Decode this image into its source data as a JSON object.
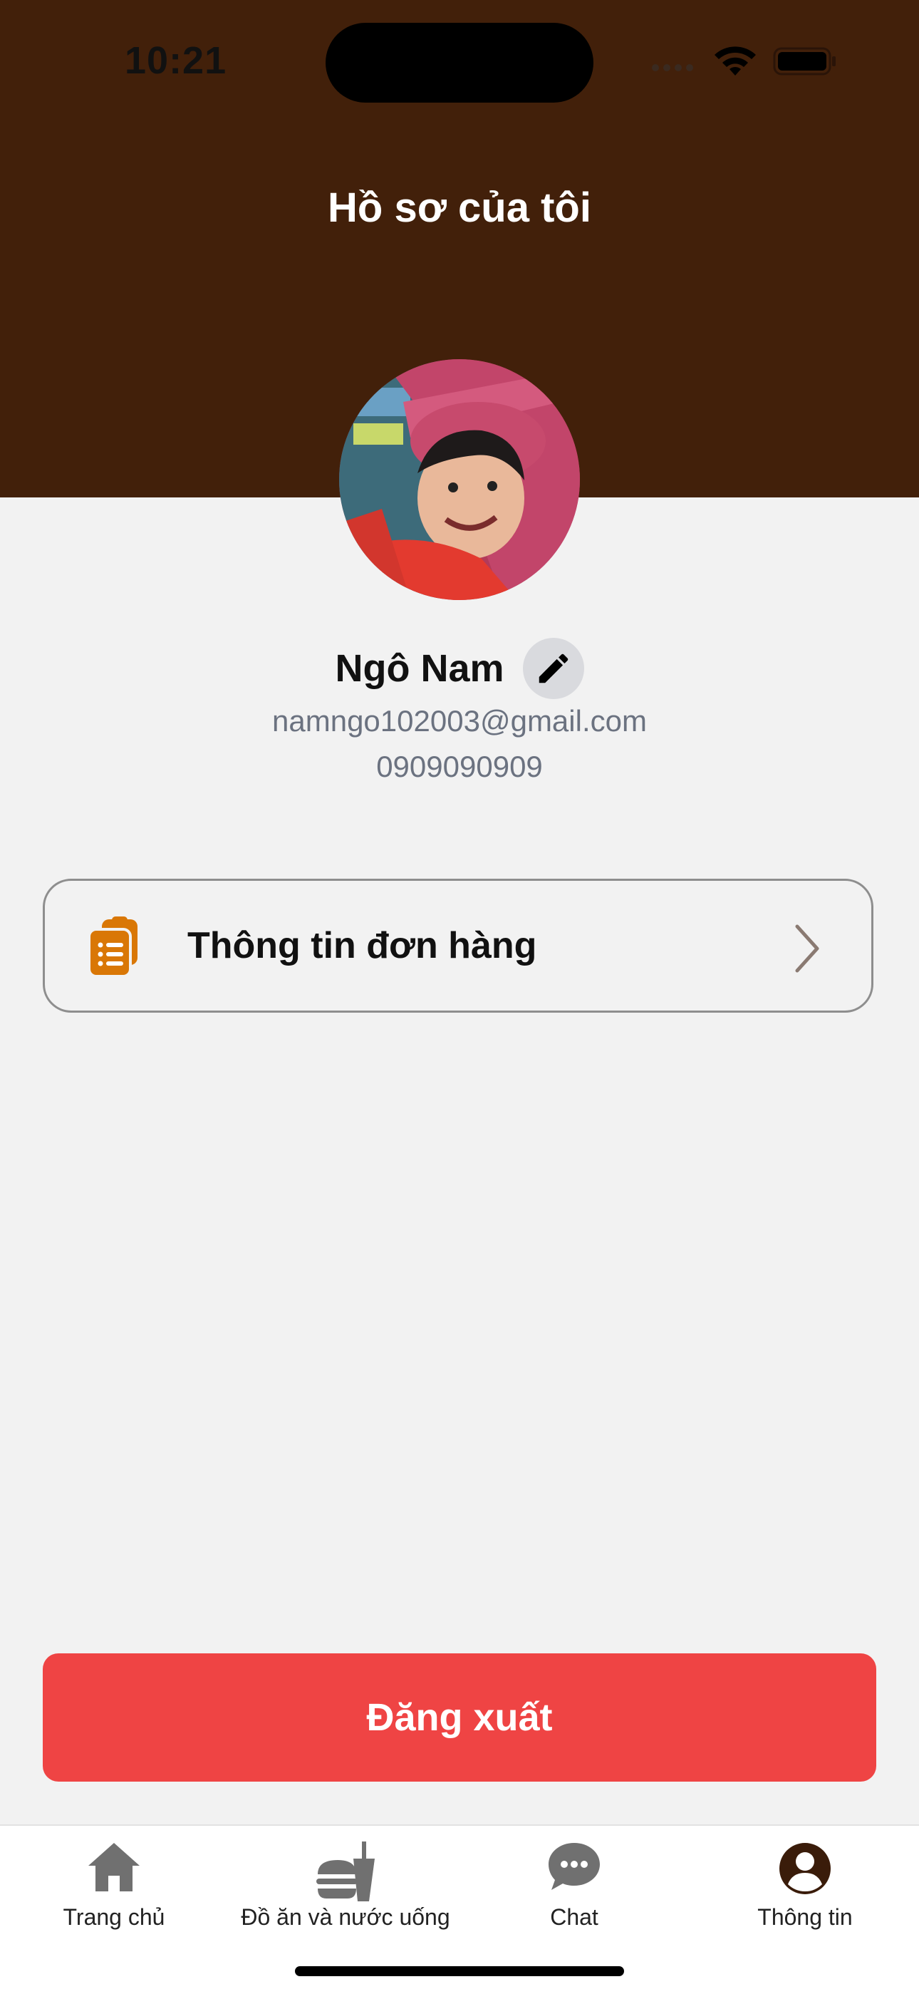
{
  "status_bar": {
    "time": "10:21"
  },
  "header": {
    "title": "Hồ sơ của tôi"
  },
  "profile": {
    "name": "Ngô Nam",
    "email": "namngo102003@gmail.com",
    "phone": "0909090909",
    "edit_icon": "pencil-icon"
  },
  "menu": {
    "order_info_label": "Thông tin đơn hàng",
    "order_icon": "clipboard-list-icon"
  },
  "actions": {
    "logout_label": "Đăng xuất"
  },
  "tabs": [
    {
      "label": "Trang chủ",
      "icon": "home-icon"
    },
    {
      "label": "Đồ ăn và nước uống",
      "icon": "food-drink-icon"
    },
    {
      "label": "Chat",
      "icon": "chat-bubble-icon"
    },
    {
      "label": "Thông tin",
      "icon": "user-circle-icon",
      "active": true
    }
  ],
  "colors": {
    "header_bg": "#42200a",
    "page_bg": "#f2f2f2",
    "logout_bg": "#ef4444",
    "order_icon": "#d97706",
    "muted_text": "#6b7280"
  }
}
